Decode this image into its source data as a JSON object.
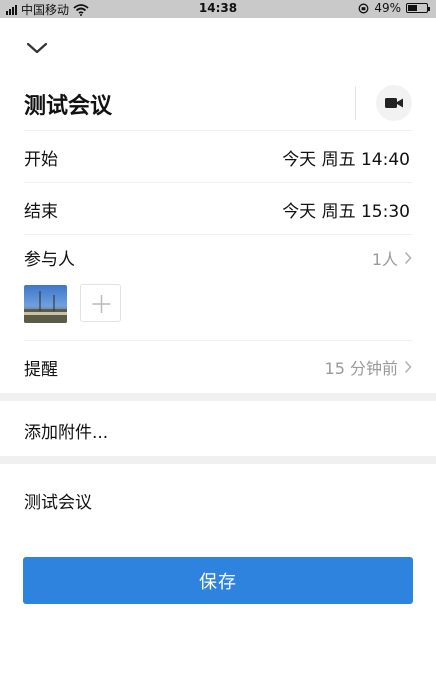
{
  "status_bar": {
    "carrier": "中国移动",
    "time": "14:38",
    "battery": "49%",
    "battery_level": 0.49
  },
  "header": {
    "collapse_icon": "chevron-down-icon",
    "title": "测试会议",
    "video_icon": "video-camera-icon"
  },
  "rows": {
    "start": {
      "label": "开始",
      "value": "今天 周五 14:40"
    },
    "end": {
      "label": "结束",
      "value": "今天 周五 15:30"
    },
    "participants": {
      "label": "参与人",
      "value": "1人"
    },
    "reminder": {
      "label": "提醒",
      "value": "15 分钟前"
    }
  },
  "attachment": {
    "label": "添加附件..."
  },
  "description": {
    "text": "测试会议"
  },
  "actions": {
    "save_label": "保存"
  },
  "colors": {
    "accent": "#2e83df",
    "muted_text": "#9a9a9a",
    "band": "#f0f0f0"
  }
}
